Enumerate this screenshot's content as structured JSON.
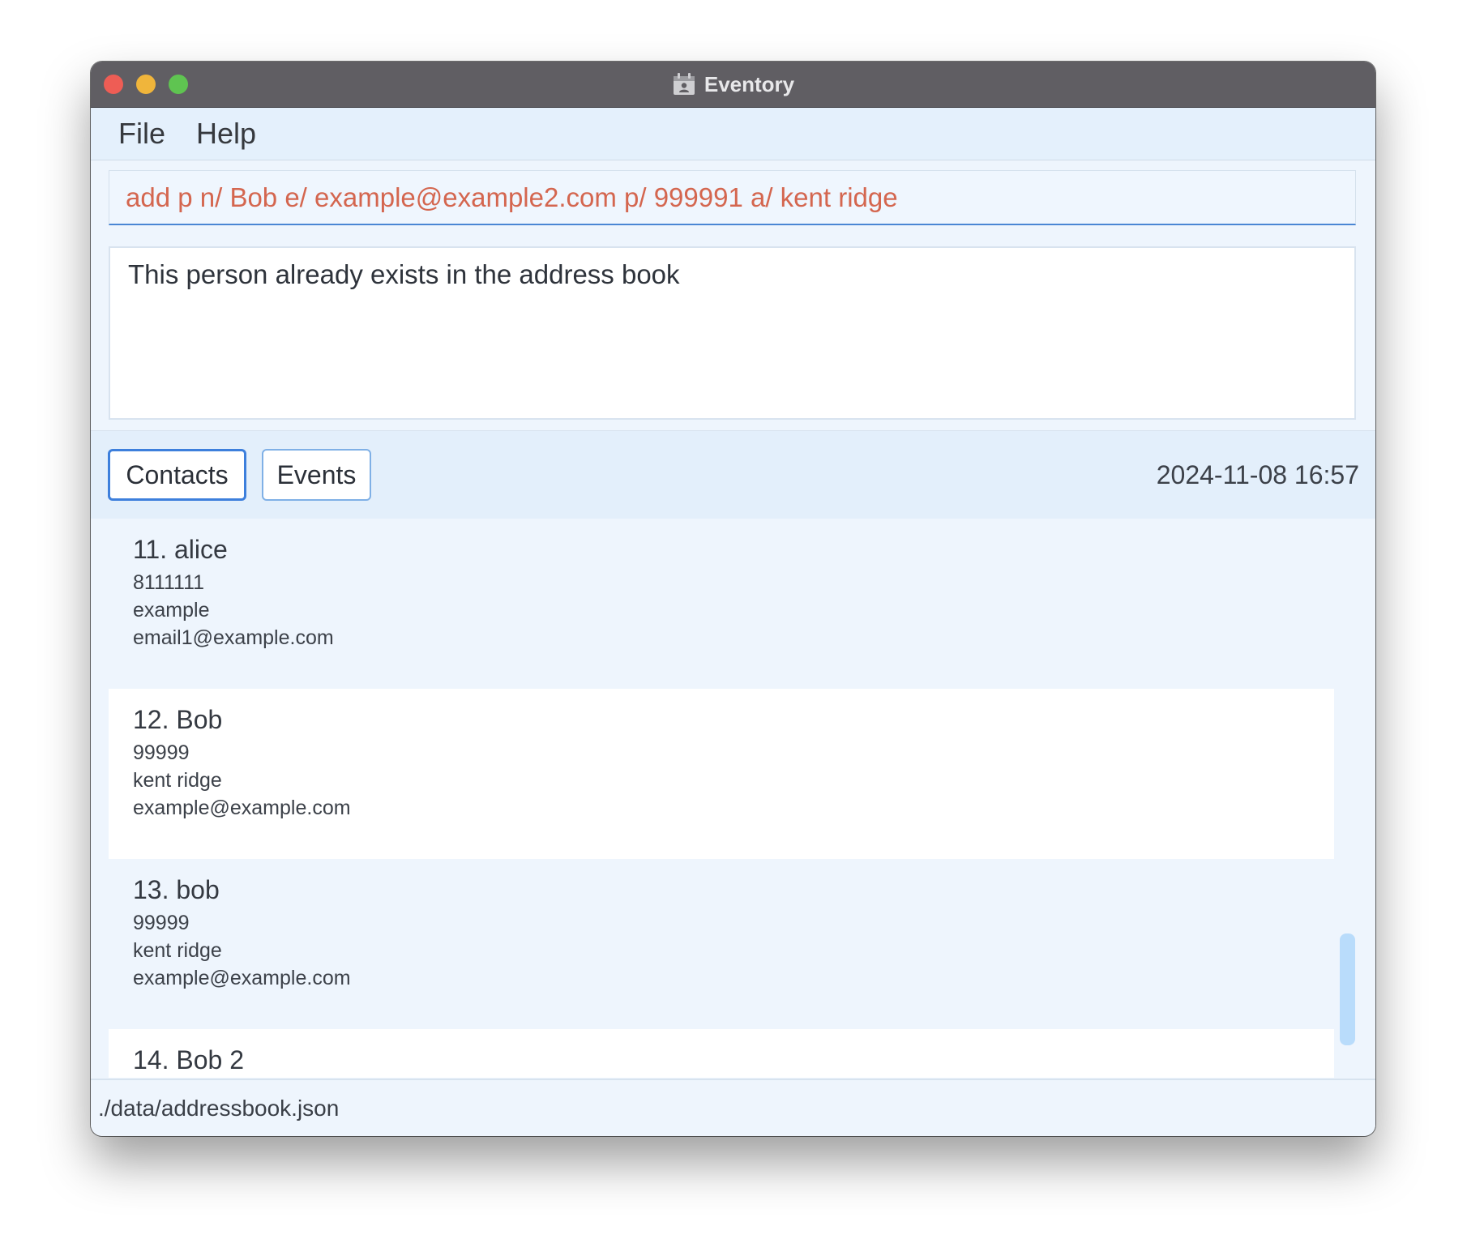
{
  "window": {
    "title": "Eventory"
  },
  "menu": {
    "file": "File",
    "help": "Help"
  },
  "command": {
    "value": "add p n/ Bob e/ example@example2.com p/ 999991 a/ kent ridge",
    "text_color": "#d4664f"
  },
  "result": {
    "message": "This person already exists in the address book"
  },
  "tabs": {
    "contacts": "Contacts",
    "events": "Events",
    "active": "Contacts"
  },
  "datetime": "2024-11-08 16:57",
  "contacts": [
    {
      "name": "11. alice",
      "phone": "8111111",
      "address": "example",
      "email": "email1@example.com"
    },
    {
      "name": "12. Bob",
      "phone": "99999",
      "address": "kent ridge",
      "email": "example@example.com"
    },
    {
      "name": "13. bob",
      "phone": "99999",
      "address": "kent ridge",
      "email": "example@example.com"
    },
    {
      "name": "14. Bob 2"
    }
  ],
  "status": {
    "path": "./data/addressbook.json"
  },
  "colors": {
    "titlebar": "#605e63",
    "accent": "#3d7fdc",
    "background": "#eef5fd",
    "close": "#ee5d55",
    "minimize": "#f0b53b",
    "maximize": "#5fc451"
  },
  "icons": {
    "app": "calendar-person-icon"
  }
}
